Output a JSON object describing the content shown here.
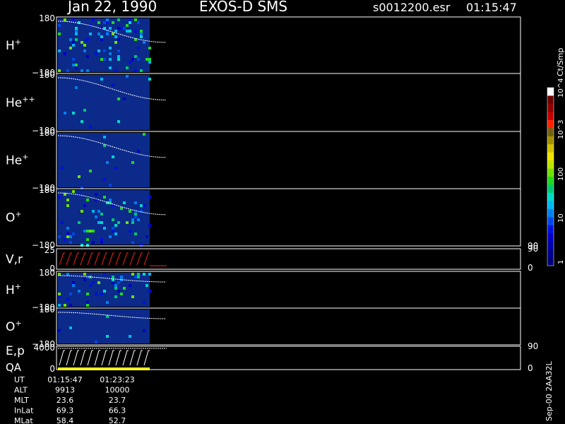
{
  "header": {
    "date": "Jan 22, 1990",
    "instrument": "EXOS-D SMS",
    "file": "s0012200.esr",
    "time": "01:15:47"
  },
  "colors": {
    "background": "#000000",
    "panel_border": "#ffffff",
    "spectrogram_fill": "#0b2a8a",
    "trace": "#ffffff",
    "vr_trace": "#ff2020",
    "qa_bar": "#ffee00"
  },
  "colorbar": {
    "label": "Ct/Smp",
    "ticks": [
      "1",
      "10",
      "100",
      "10^3",
      "10^4"
    ],
    "scale": "log",
    "colors": [
      "#00007a",
      "#00008e",
      "#0000a8",
      "#0000c4",
      "#0010dc",
      "#0048e8",
      "#0080f0",
      "#00b8f0",
      "#00d8c8",
      "#00c870",
      "#20d820",
      "#70e000",
      "#c0e400",
      "#f0e000",
      "#d0c000",
      "#a09000",
      "#706010",
      "#ff2000",
      "#c00000",
      "#900000",
      "#700000",
      "#ffffff"
    ]
  },
  "footer_code": "Sep-00 2AA32L",
  "chart_data": [
    {
      "type": "heatmap",
      "panel": "H+",
      "ylabel": "H",
      "ylabel_sup": "+",
      "ymax_label": "180",
      "ymin_label": "−180",
      "ylim": [
        -180,
        180
      ],
      "has_data_until": "01:23:23"
    },
    {
      "type": "heatmap",
      "panel": "He++",
      "ylabel": "He",
      "ylabel_sup": "++",
      "ymax_label": "180",
      "ymin_label": "−180",
      "ylim": [
        -180,
        180
      ]
    },
    {
      "type": "heatmap",
      "panel": "He+",
      "ylabel": "He",
      "ylabel_sup": "+",
      "ymax_label": "180",
      "ymin_label": "−180",
      "ylim": [
        -180,
        180
      ]
    },
    {
      "type": "heatmap",
      "panel": "O+",
      "ylabel": "O",
      "ylabel_sup": "+",
      "ymax_label": "180",
      "ymin_label": "−180",
      "ylim": [
        -180,
        180
      ],
      "right_label": "90"
    },
    {
      "type": "line",
      "panel": "V,r",
      "ylabel": "V,r",
      "ymax_label": "25",
      "ymin_label": "0",
      "right_top": "90",
      "right_bottom": "0"
    },
    {
      "type": "heatmap",
      "panel": "H+ (2)",
      "ylabel": "H",
      "ylabel_sup": "+",
      "ymax_label": "180",
      "ymin_label": "−180",
      "ylim": [
        -180,
        180
      ]
    },
    {
      "type": "heatmap",
      "panel": "O+ (2)",
      "ylabel": "O",
      "ylabel_sup": "+",
      "ymax_label": "180",
      "ymin_label": "−180",
      "ylim": [
        -180,
        180
      ]
    },
    {
      "type": "line",
      "panel": "E,p / QA",
      "ylabel": "E,p",
      "ylabel2": "QA",
      "ymax_label": "4000",
      "ymin_label": "0",
      "right_top": "90",
      "right_bottom": "0"
    }
  ],
  "ephemeris": {
    "rows": [
      {
        "label": "UT",
        "v1": "01:15:47",
        "v2": "01:23:23"
      },
      {
        "label": "ALT",
        "v1": "9913",
        "v2": "10000"
      },
      {
        "label": "MLT",
        "v1": "23.6",
        "v2": "23.7"
      },
      {
        "label": "InLat",
        "v1": "69.3",
        "v2": "66.3"
      },
      {
        "label": "MLat",
        "v1": "58.4",
        "v2": "52.7"
      }
    ]
  }
}
